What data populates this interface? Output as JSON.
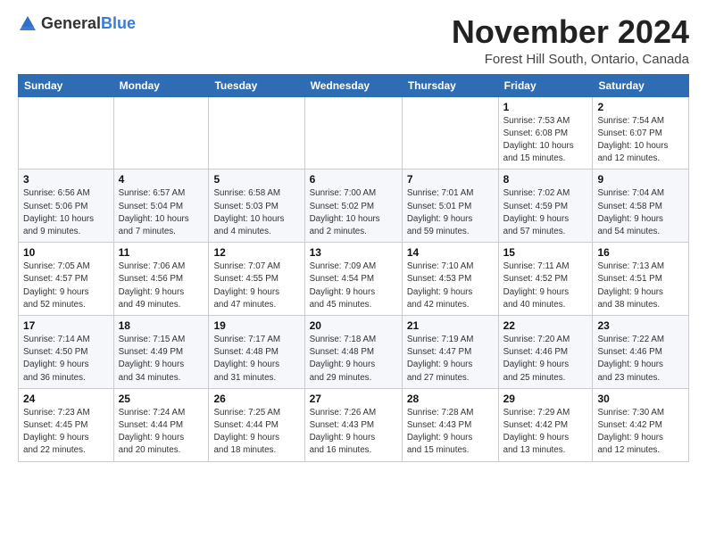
{
  "logo": {
    "general": "General",
    "blue": "Blue"
  },
  "header": {
    "month_title": "November 2024",
    "location": "Forest Hill South, Ontario, Canada"
  },
  "weekdays": [
    "Sunday",
    "Monday",
    "Tuesday",
    "Wednesday",
    "Thursday",
    "Friday",
    "Saturday"
  ],
  "weeks": [
    [
      {
        "day": "",
        "detail": ""
      },
      {
        "day": "",
        "detail": ""
      },
      {
        "day": "",
        "detail": ""
      },
      {
        "day": "",
        "detail": ""
      },
      {
        "day": "",
        "detail": ""
      },
      {
        "day": "1",
        "detail": "Sunrise: 7:53 AM\nSunset: 6:08 PM\nDaylight: 10 hours\nand 15 minutes."
      },
      {
        "day": "2",
        "detail": "Sunrise: 7:54 AM\nSunset: 6:07 PM\nDaylight: 10 hours\nand 12 minutes."
      }
    ],
    [
      {
        "day": "3",
        "detail": "Sunrise: 6:56 AM\nSunset: 5:06 PM\nDaylight: 10 hours\nand 9 minutes."
      },
      {
        "day": "4",
        "detail": "Sunrise: 6:57 AM\nSunset: 5:04 PM\nDaylight: 10 hours\nand 7 minutes."
      },
      {
        "day": "5",
        "detail": "Sunrise: 6:58 AM\nSunset: 5:03 PM\nDaylight: 10 hours\nand 4 minutes."
      },
      {
        "day": "6",
        "detail": "Sunrise: 7:00 AM\nSunset: 5:02 PM\nDaylight: 10 hours\nand 2 minutes."
      },
      {
        "day": "7",
        "detail": "Sunrise: 7:01 AM\nSunset: 5:01 PM\nDaylight: 9 hours\nand 59 minutes."
      },
      {
        "day": "8",
        "detail": "Sunrise: 7:02 AM\nSunset: 4:59 PM\nDaylight: 9 hours\nand 57 minutes."
      },
      {
        "day": "9",
        "detail": "Sunrise: 7:04 AM\nSunset: 4:58 PM\nDaylight: 9 hours\nand 54 minutes."
      }
    ],
    [
      {
        "day": "10",
        "detail": "Sunrise: 7:05 AM\nSunset: 4:57 PM\nDaylight: 9 hours\nand 52 minutes."
      },
      {
        "day": "11",
        "detail": "Sunrise: 7:06 AM\nSunset: 4:56 PM\nDaylight: 9 hours\nand 49 minutes."
      },
      {
        "day": "12",
        "detail": "Sunrise: 7:07 AM\nSunset: 4:55 PM\nDaylight: 9 hours\nand 47 minutes."
      },
      {
        "day": "13",
        "detail": "Sunrise: 7:09 AM\nSunset: 4:54 PM\nDaylight: 9 hours\nand 45 minutes."
      },
      {
        "day": "14",
        "detail": "Sunrise: 7:10 AM\nSunset: 4:53 PM\nDaylight: 9 hours\nand 42 minutes."
      },
      {
        "day": "15",
        "detail": "Sunrise: 7:11 AM\nSunset: 4:52 PM\nDaylight: 9 hours\nand 40 minutes."
      },
      {
        "day": "16",
        "detail": "Sunrise: 7:13 AM\nSunset: 4:51 PM\nDaylight: 9 hours\nand 38 minutes."
      }
    ],
    [
      {
        "day": "17",
        "detail": "Sunrise: 7:14 AM\nSunset: 4:50 PM\nDaylight: 9 hours\nand 36 minutes."
      },
      {
        "day": "18",
        "detail": "Sunrise: 7:15 AM\nSunset: 4:49 PM\nDaylight: 9 hours\nand 34 minutes."
      },
      {
        "day": "19",
        "detail": "Sunrise: 7:17 AM\nSunset: 4:48 PM\nDaylight: 9 hours\nand 31 minutes."
      },
      {
        "day": "20",
        "detail": "Sunrise: 7:18 AM\nSunset: 4:48 PM\nDaylight: 9 hours\nand 29 minutes."
      },
      {
        "day": "21",
        "detail": "Sunrise: 7:19 AM\nSunset: 4:47 PM\nDaylight: 9 hours\nand 27 minutes."
      },
      {
        "day": "22",
        "detail": "Sunrise: 7:20 AM\nSunset: 4:46 PM\nDaylight: 9 hours\nand 25 minutes."
      },
      {
        "day": "23",
        "detail": "Sunrise: 7:22 AM\nSunset: 4:46 PM\nDaylight: 9 hours\nand 23 minutes."
      }
    ],
    [
      {
        "day": "24",
        "detail": "Sunrise: 7:23 AM\nSunset: 4:45 PM\nDaylight: 9 hours\nand 22 minutes."
      },
      {
        "day": "25",
        "detail": "Sunrise: 7:24 AM\nSunset: 4:44 PM\nDaylight: 9 hours\nand 20 minutes."
      },
      {
        "day": "26",
        "detail": "Sunrise: 7:25 AM\nSunset: 4:44 PM\nDaylight: 9 hours\nand 18 minutes."
      },
      {
        "day": "27",
        "detail": "Sunrise: 7:26 AM\nSunset: 4:43 PM\nDaylight: 9 hours\nand 16 minutes."
      },
      {
        "day": "28",
        "detail": "Sunrise: 7:28 AM\nSunset: 4:43 PM\nDaylight: 9 hours\nand 15 minutes."
      },
      {
        "day": "29",
        "detail": "Sunrise: 7:29 AM\nSunset: 4:42 PM\nDaylight: 9 hours\nand 13 minutes."
      },
      {
        "day": "30",
        "detail": "Sunrise: 7:30 AM\nSunset: 4:42 PM\nDaylight: 9 hours\nand 12 minutes."
      }
    ]
  ]
}
